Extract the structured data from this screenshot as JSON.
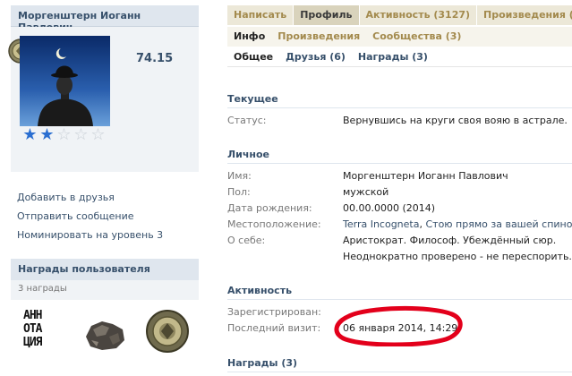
{
  "user": {
    "name": "Моргенштерн Иоганн Павлович",
    "rating": "74.15",
    "stars_filled": 2,
    "stars_total": 5
  },
  "actions": {
    "add_friend": "Добавить в друзья",
    "send_message": "Отправить сообщение",
    "nominate": "Номинировать на уровень 3"
  },
  "awards": {
    "title": "Награды пользователя",
    "count": "3 награды"
  },
  "tabs_main": [
    "Написать",
    "Профиль",
    "Активность (3127)",
    "Произведения (1"
  ],
  "tabs_sub": [
    "Инфо",
    "Произведения",
    "Сообщества (3)"
  ],
  "tabs_info": [
    "Общее",
    "Друзья (6)",
    "Награды (3)"
  ],
  "current": {
    "title": "Текущее",
    "status_label": "Статус:",
    "status_value": "Вернувшись на круги своя вояю в астрале."
  },
  "personal": {
    "title": "Личное",
    "name_label": "Имя:",
    "name_value": "Моргенштерн Иоганн Павлович",
    "sex_label": "Пол:",
    "sex_value": "мужской",
    "birth_label": "Дата рождения:",
    "birth_value": "00.00.0000 (2014)",
    "location_label": "Местоположение:",
    "location_link1": "Terra Incogneta",
    "location_sep": ", ",
    "location_link2": "Стою прямо за вашей спиной.",
    "about_label": "О себе:",
    "about_line1": "Аристократ. Философ. Убеждённый сюр.",
    "about_line2": "Неоднократно проверено - не переспорить."
  },
  "activity": {
    "title": "Активность",
    "registered_label": "Зарегистрирован:",
    "last_visit_label": "Последний визит:",
    "last_visit_value": "06 января 2014, 14:29"
  },
  "awards_section": {
    "title": "Награды (3)"
  },
  "award_badge_text": "АННОТАЦИЯ",
  "colors": {
    "accent": "#37506b",
    "tab_gold": "#a38a4d",
    "star_blue": "#2b6fd1",
    "highlight_red": "#e3001b"
  }
}
